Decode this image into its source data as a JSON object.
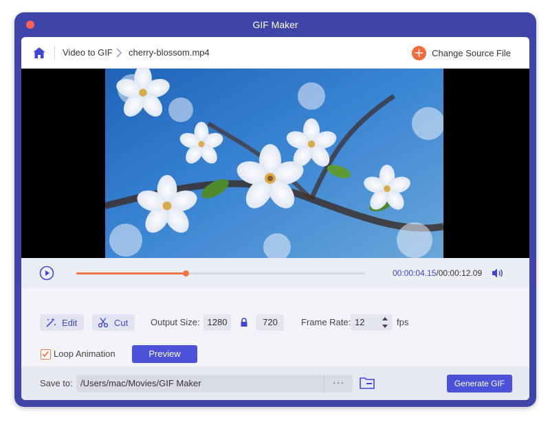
{
  "window": {
    "title": "GIF Maker"
  },
  "breadcrumb": {
    "section": "Video to GIF",
    "file": "cherry-blossom.mp4"
  },
  "header": {
    "change_source_label": "Change Source File"
  },
  "playback": {
    "current_time": "00:00:04.15",
    "total_time": "/00:00:12.09",
    "progress": 0.378
  },
  "settings": {
    "edit_label": "Edit",
    "cut_label": "Cut",
    "output_size_label": "Output Size:",
    "width": "1280",
    "height": "720",
    "frame_rate_label": "Frame Rate:",
    "frame_rate": "12",
    "fps_label": "fps",
    "loop_label": "Loop Animation",
    "loop_checked": true,
    "preview_label": "Preview"
  },
  "save": {
    "label": "Save to:",
    "path": "/Users/mac/Movies/GIF Maker",
    "browse_label": "···",
    "generate_label": "Generate GIF"
  },
  "colors": {
    "accent": "#4c51d9",
    "window_frame": "#3f45a8",
    "progress": "#f07444"
  }
}
